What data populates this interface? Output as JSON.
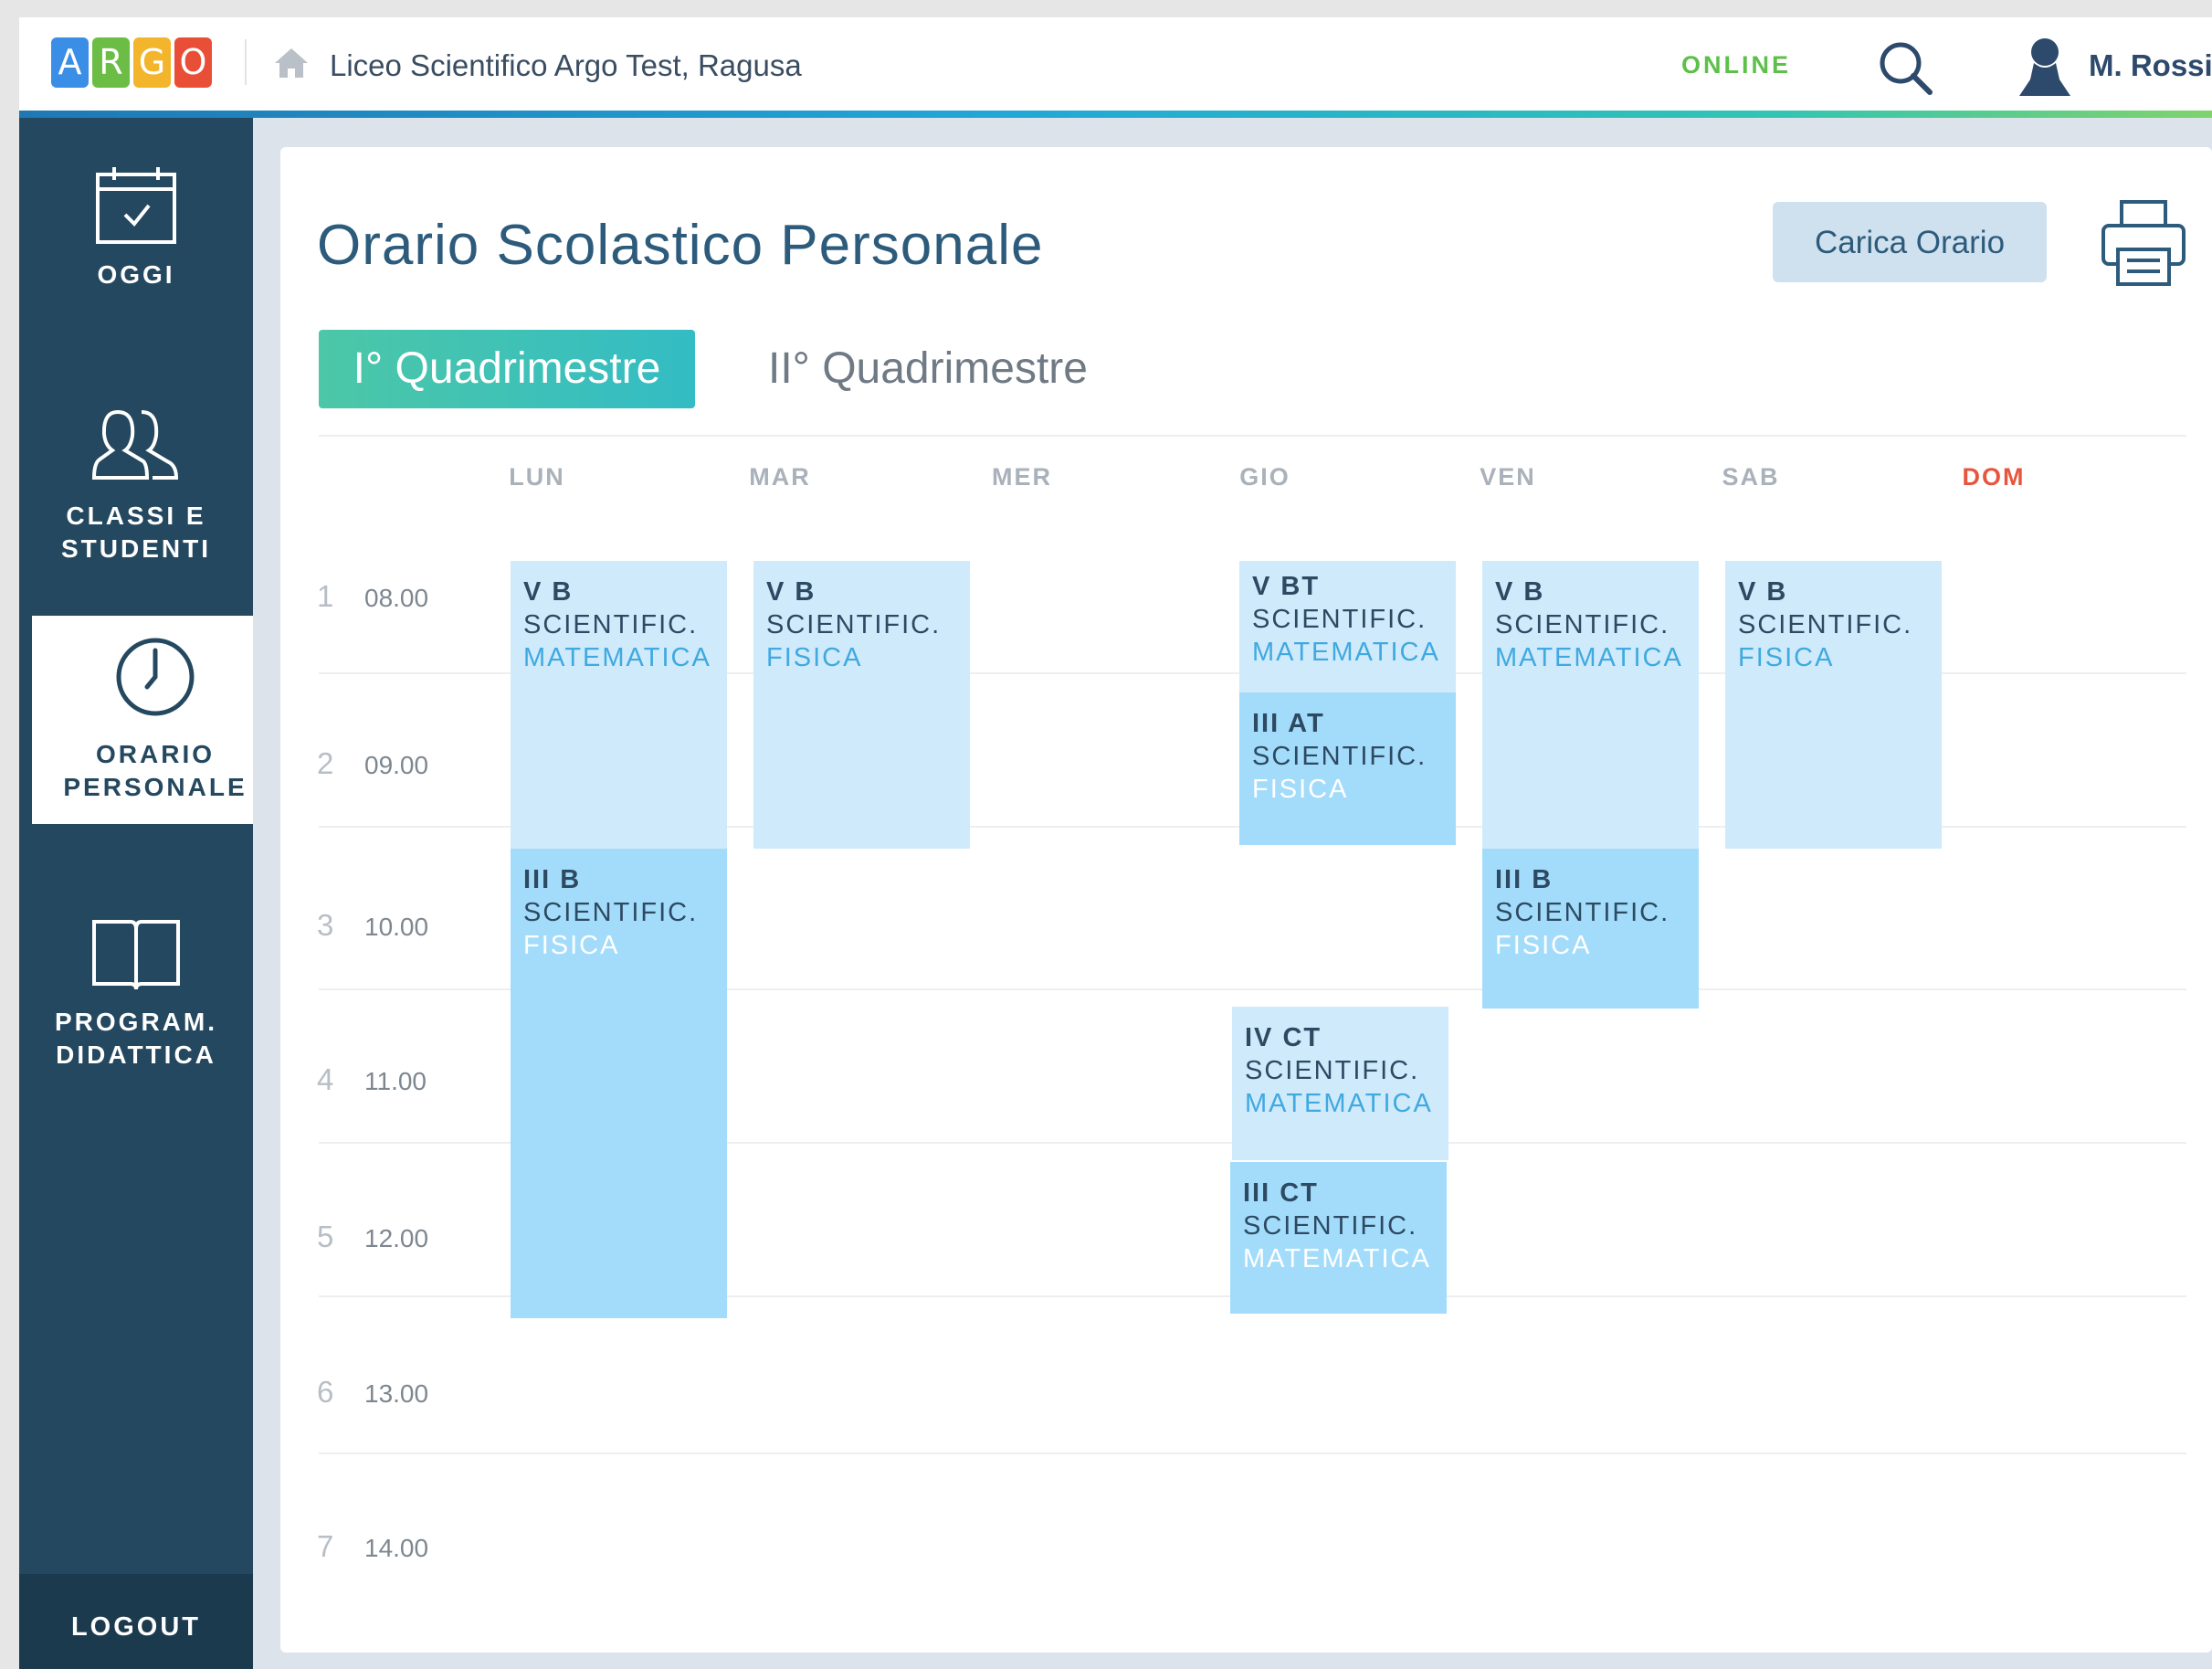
{
  "header": {
    "logo_letters": [
      "A",
      "R",
      "G",
      "O"
    ],
    "school_name": "Liceo Scientifico Argo Test, Ragusa",
    "status": "ONLINE",
    "user_name": "M. Rossi"
  },
  "sidebar": {
    "items": [
      {
        "label_line1": "OGGI",
        "label_line2": "",
        "icon": "calendar-icon"
      },
      {
        "label_line1": "CLASSI E",
        "label_line2": "STUDENTI",
        "icon": "users-icon"
      },
      {
        "label_line1": "ORARIO",
        "label_line2": "PERSONALE",
        "icon": "clock-icon",
        "active": true
      },
      {
        "label_line1": "PROGRAM.",
        "label_line2": "DIDATTICA",
        "icon": "book-icon"
      }
    ],
    "logout_label": "LOGOUT"
  },
  "main": {
    "title": "Orario Scolastico Personale",
    "load_button": "Carica Orario",
    "tabs": [
      {
        "label": "I° Quadrimestre",
        "active": true
      },
      {
        "label": "II° Quadrimestre",
        "active": false
      }
    ]
  },
  "schedule": {
    "days": [
      "LUN",
      "MAR",
      "MER",
      "GIO",
      "VEN",
      "SAB",
      "DOM"
    ],
    "hours": [
      {
        "num": "1",
        "time": "08.00"
      },
      {
        "num": "2",
        "time": "09.00"
      },
      {
        "num": "3",
        "time": "10.00"
      },
      {
        "num": "4",
        "time": "11.00"
      },
      {
        "num": "5",
        "time": "12.00"
      },
      {
        "num": "6",
        "time": "13.00"
      },
      {
        "num": "7",
        "time": "14.00"
      }
    ],
    "lessons": [
      {
        "day": "LUN",
        "class": "V B",
        "school": "SCIENTIFIC.",
        "subject": "MATEMATICA",
        "hours": "1-2"
      },
      {
        "day": "LUN",
        "class": "III B",
        "school": "SCIENTIFIC.",
        "subject": "FISICA",
        "hours": "3-5"
      },
      {
        "day": "MAR",
        "class": "V B",
        "school": "SCIENTIFIC.",
        "subject": "FISICA",
        "hours": "1-2"
      },
      {
        "day": "GIO",
        "class": "V BT",
        "school": "SCIENTIFIC.",
        "subject": "MATEMATICA",
        "hours": "1"
      },
      {
        "day": "GIO",
        "class": "III AT",
        "school": "SCIENTIFIC.",
        "subject": "FISICA",
        "hours": "2"
      },
      {
        "day": "GIO",
        "class": "IV CT",
        "school": "SCIENTIFIC.",
        "subject": "MATEMATICA",
        "hours": "4"
      },
      {
        "day": "GIO",
        "class": "III CT",
        "school": "SCIENTIFIC.",
        "subject": "MATEMATICA",
        "hours": "5"
      },
      {
        "day": "VEN",
        "class": "V B",
        "school": "SCIENTIFIC.",
        "subject": "MATEMATICA",
        "hours": "1-2"
      },
      {
        "day": "VEN",
        "class": "III B",
        "school": "SCIENTIFIC.",
        "subject": "FISICA",
        "hours": "3"
      },
      {
        "day": "SAB",
        "class": "V B",
        "school": "SCIENTIFIC.",
        "subject": "FISICA",
        "hours": "1-2"
      }
    ]
  },
  "colors": {
    "sidebar": "#24485f",
    "accent_green": "#5ec04a",
    "sunday_red": "#e8553e",
    "lesson_light": "#cfeafb",
    "lesson_dark": "#a3dcfa",
    "tab_active": "#33bcc4"
  }
}
